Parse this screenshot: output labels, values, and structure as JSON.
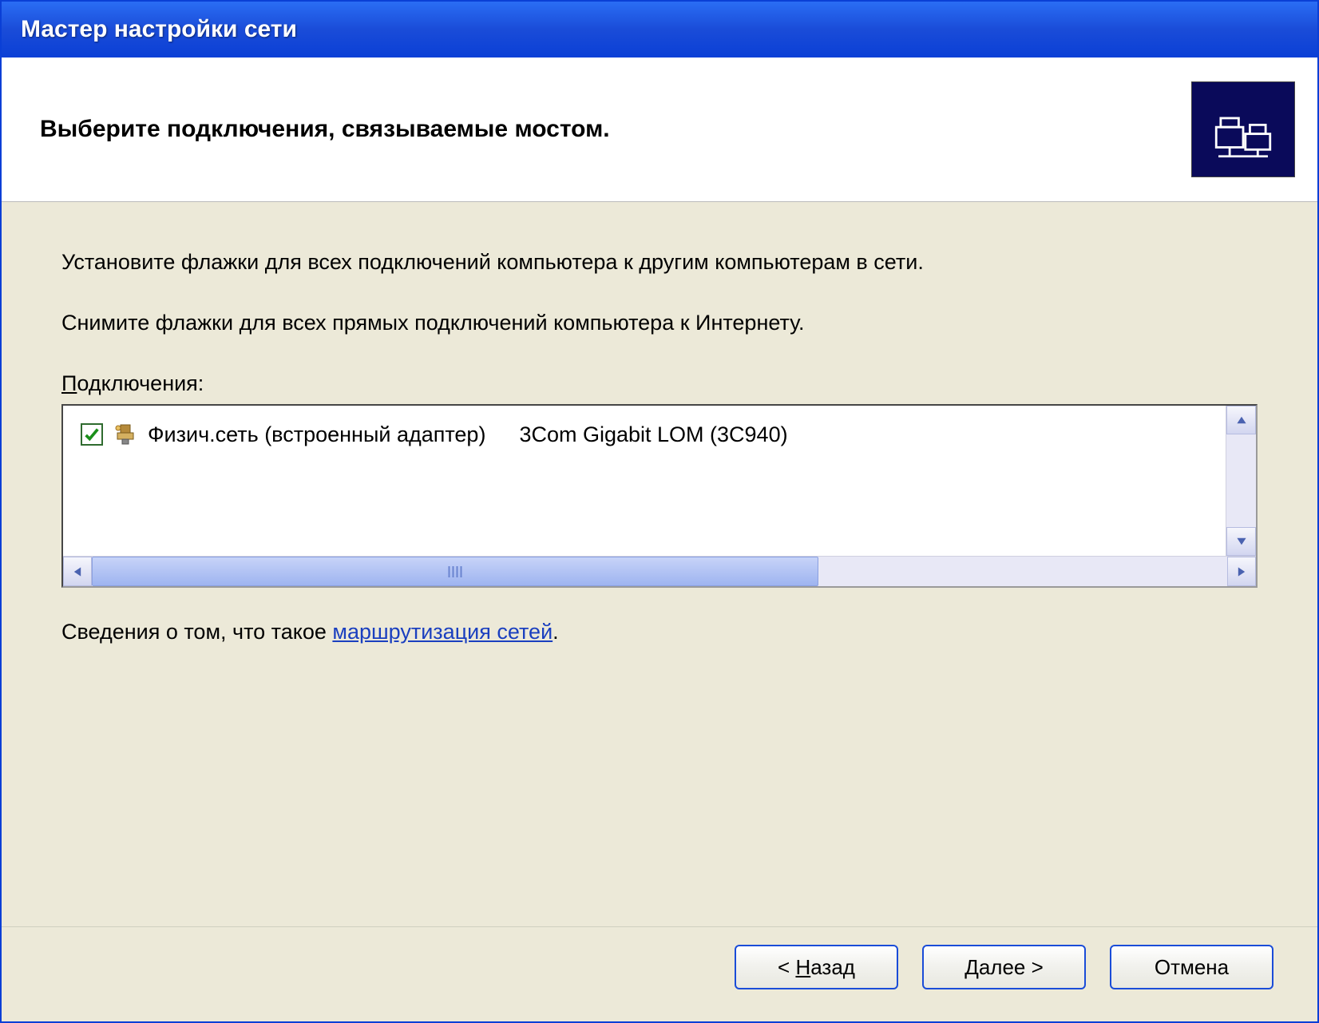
{
  "window": {
    "title": "Мастер настройки сети"
  },
  "header": {
    "heading": "Выберите подключения, связываемые мостом."
  },
  "content": {
    "instruction1": "Установите флажки для всех подключений компьютера к другим компьютерам в сети.",
    "instruction2": "Снимите флажки для всех прямых подключений компьютера к Интернету.",
    "list_label_prefix": "П",
    "list_label_rest": "одключения:",
    "connections": [
      {
        "checked": true,
        "name": "Физич.сеть (встроенный адаптер)",
        "device": "3Com Gigabit LOM (3C940)"
      }
    ],
    "info_prefix": "Сведения о том, что такое ",
    "info_link": "маршрутизация сетей",
    "info_suffix": "."
  },
  "buttons": {
    "back_prefix": "< ",
    "back_u": "Н",
    "back_rest": "азад",
    "next_u": "Д",
    "next_rest": "алее >",
    "cancel": "Отмена"
  }
}
